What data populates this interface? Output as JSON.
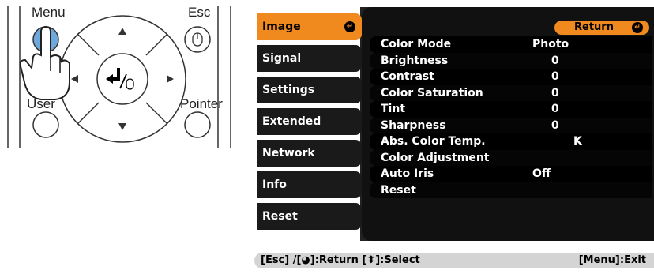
{
  "remote": {
    "menu_label": "Menu",
    "esc_label": "Esc",
    "user_label": "User",
    "pointer_label": "Pointer"
  },
  "sidebar": {
    "items": [
      {
        "label": "Image",
        "active": true
      },
      {
        "label": "Signal"
      },
      {
        "label": "Settings"
      },
      {
        "label": "Extended"
      },
      {
        "label": "Network"
      },
      {
        "label": "Info"
      },
      {
        "label": "Reset"
      }
    ]
  },
  "content": {
    "return_label": "Return",
    "options": [
      {
        "name": "Color Mode",
        "value": "Photo"
      },
      {
        "name": "Brightness",
        "value": "0"
      },
      {
        "name": "Contrast",
        "value": "0"
      },
      {
        "name": "Color Saturation",
        "value": "0"
      },
      {
        "name": "Tint",
        "value": "0"
      },
      {
        "name": "Sharpness",
        "value": "0"
      },
      {
        "name": "Abs. Color Temp.",
        "value": "K"
      },
      {
        "name": "Color Adjustment",
        "value": ""
      },
      {
        "name": "Auto Iris",
        "value": "Off"
      },
      {
        "name": "Reset",
        "value": ""
      }
    ]
  },
  "bottom_bar": {
    "left_hint": "[Esc] /[◕]:Return  [⬍]:Select",
    "right_hint": "[Menu]:Exit"
  },
  "colors": {
    "accent": "#f08a1e",
    "panel": "#222222",
    "row": "#000000",
    "bar": "#d4d4d4"
  },
  "icons": [
    "hand-pointer-icon",
    "enter-arrow-icon",
    "up-arrow-icon",
    "down-arrow-icon",
    "left-arrow-icon",
    "right-arrow-icon",
    "mouse-icon"
  ]
}
